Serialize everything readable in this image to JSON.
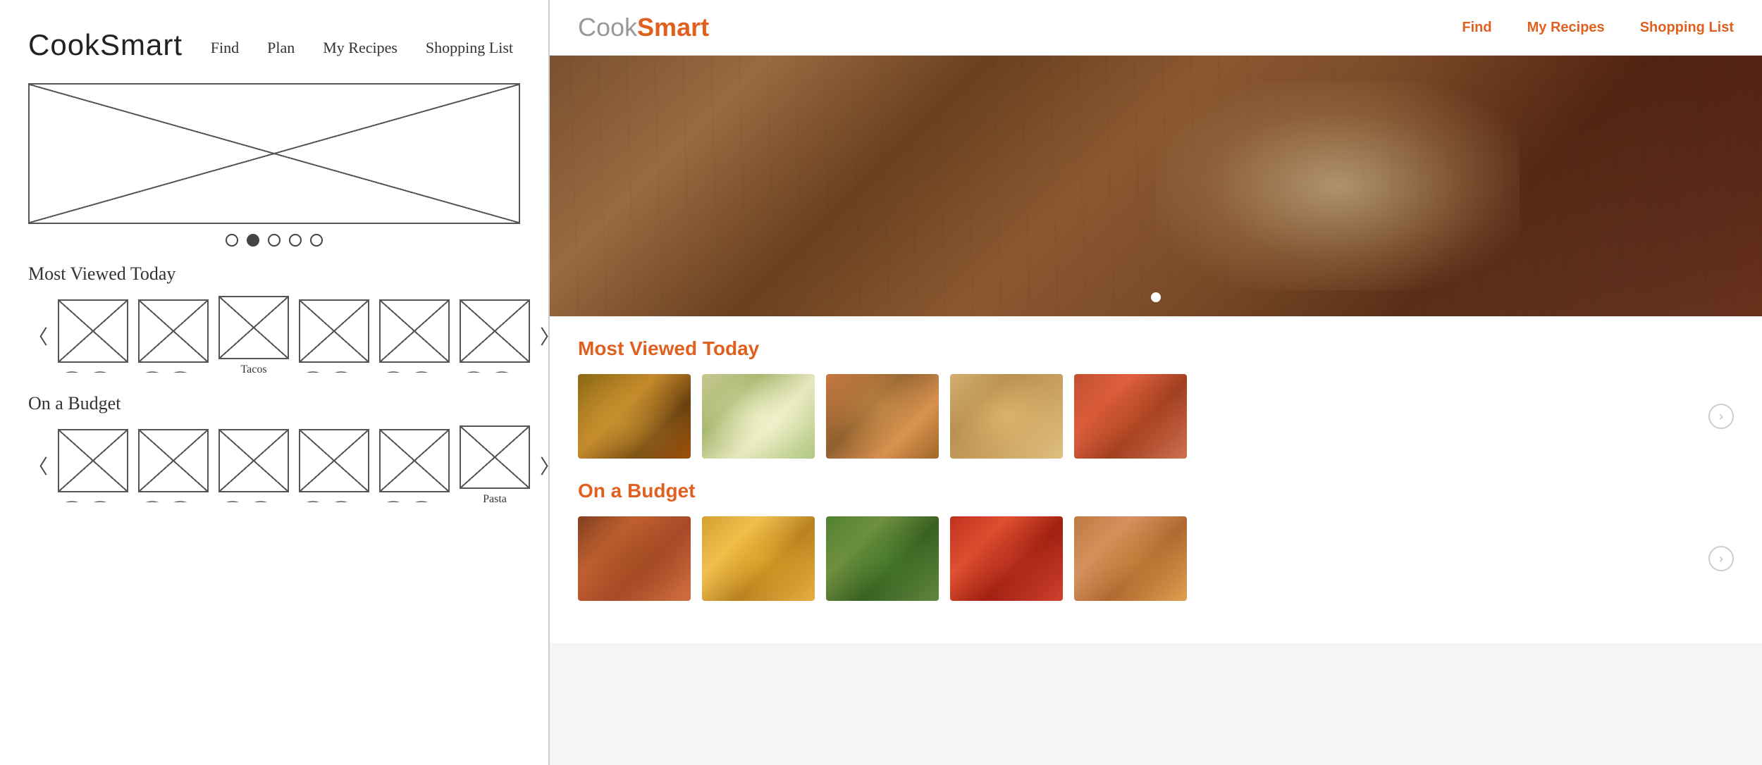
{
  "left_panel": {
    "logo": "CookSmart",
    "nav": {
      "find": "Find",
      "plan": "Plan",
      "my_recipes": "My Recipes",
      "shopping_list": "Shopping List"
    },
    "section1_title": "Most Viewed Today",
    "section2_title": "On a Budget",
    "items_row1": [
      {
        "label": ""
      },
      {
        "label": ""
      },
      {
        "label": "Tacos"
      },
      {
        "label": ""
      },
      {
        "label": ""
      },
      {
        "label": ""
      }
    ],
    "items_row2": [
      {
        "label": ""
      },
      {
        "label": ""
      },
      {
        "label": ""
      },
      {
        "label": ""
      },
      {
        "label": ""
      },
      {
        "label": "Pasta"
      }
    ],
    "dots": [
      "empty",
      "filled",
      "empty",
      "empty",
      "empty"
    ]
  },
  "right_panel": {
    "logo_cook": "Cook",
    "logo_smart": "Smart",
    "nav": {
      "find": "Find",
      "my_recipes": "My Recipes",
      "shopping_list": "Shopping List"
    },
    "section1_title": "Most Viewed Today",
    "section2_title": "On a Budget",
    "row1_cards": [
      "recipe-card-1",
      "recipe-card-2",
      "recipe-card-3",
      "recipe-card-4",
      "recipe-card-5"
    ],
    "row2_cards": [
      "recipe-card-b1",
      "recipe-card-b2",
      "recipe-card-b3",
      "recipe-card-b4",
      "recipe-card-b5"
    ],
    "chevron_right": "›"
  }
}
